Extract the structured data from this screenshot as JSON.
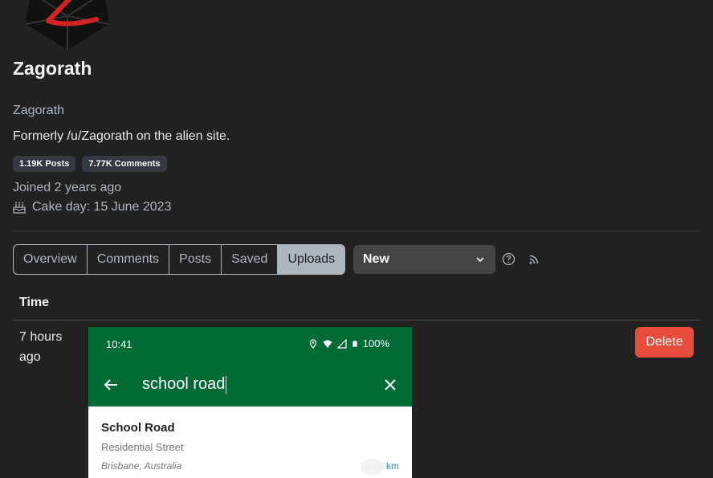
{
  "profile": {
    "display_name": "Zagorath",
    "username": "Zagorath",
    "bio": "Formerly /u/Zagorath on the alien site.",
    "badges": {
      "posts": "1.19K Posts",
      "comments": "7.77K Comments"
    },
    "joined": "Joined 2 years ago",
    "cake_day": "Cake day: 15 June 2023"
  },
  "tabs": [
    {
      "label": "Overview",
      "active": false
    },
    {
      "label": "Comments",
      "active": false
    },
    {
      "label": "Posts",
      "active": false
    },
    {
      "label": "Saved",
      "active": false
    },
    {
      "label": "Uploads",
      "active": true
    }
  ],
  "sort": {
    "selected": "New"
  },
  "icons": {
    "avatar": "d20-die-icon",
    "cake": "cake-icon",
    "help": "help-circle-icon",
    "rss": "rss-icon",
    "chevron": "chevron-down-icon"
  },
  "table": {
    "header_time": "Time",
    "rows": [
      {
        "time_line1": "7 hours",
        "time_line2": "ago",
        "delete_label": "Delete"
      }
    ]
  },
  "upload_screenshot": {
    "status_time": "10:41",
    "battery": "100%",
    "search_query": "school road",
    "result": {
      "title": "School Road",
      "type": "Residential Street",
      "place": "Brisbane, Australia",
      "distance_unit": "km"
    }
  },
  "colors": {
    "background": "#222222",
    "delete": "#e74c3c",
    "phone_header": "#006b35",
    "active_tab": "#adb5bd"
  }
}
